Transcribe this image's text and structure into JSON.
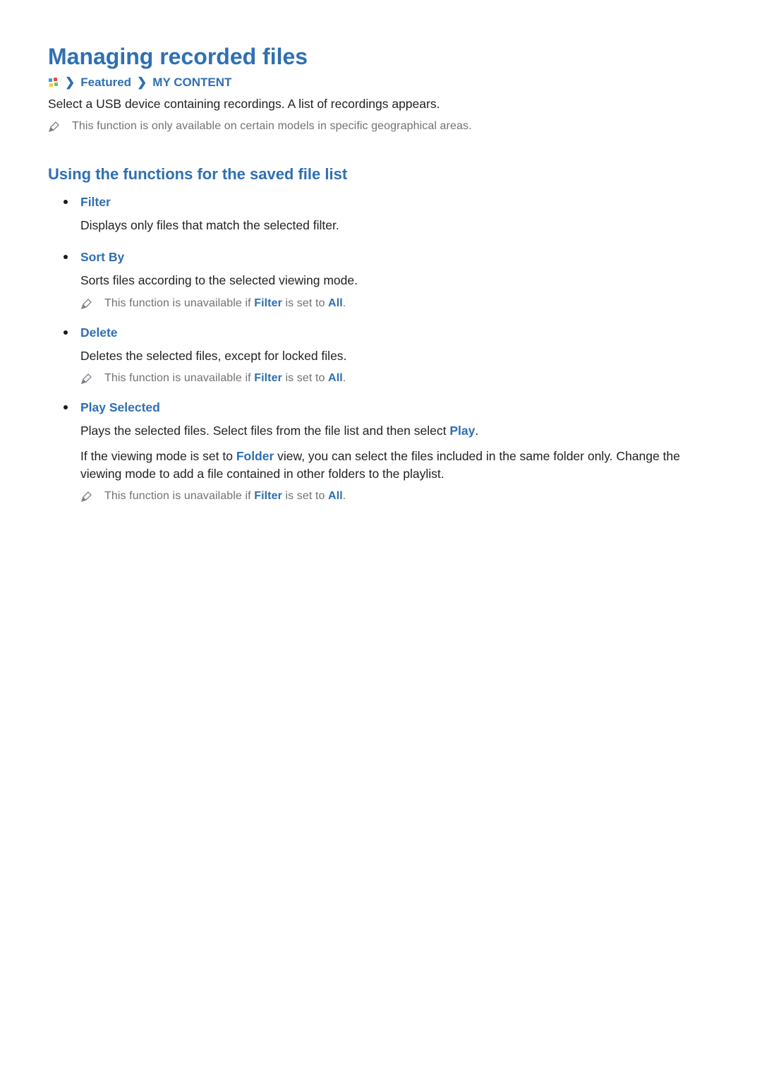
{
  "title": "Managing recorded files",
  "breadcrumb": {
    "item1": "Featured",
    "item2": "MY CONTENT"
  },
  "intro": "Select a USB device containing recordings. A list of recordings appears.",
  "global_note": "This function is only available on certain models in specific geographical areas.",
  "subheading": "Using the functions for the saved file list",
  "items": {
    "filter": {
      "name": "Filter",
      "desc": "Displays only files that match the selected filter."
    },
    "sortby": {
      "name": "Sort By",
      "desc": "Sorts files according to the selected viewing mode.",
      "note_pre": "This function is unavailable if ",
      "note_kw1": "Filter",
      "note_mid": " is set to ",
      "note_kw2": "All",
      "note_post": "."
    },
    "delete": {
      "name": "Delete",
      "desc": "Deletes the selected files, except for locked files.",
      "note_pre": "This function is unavailable if ",
      "note_kw1": "Filter",
      "note_mid": " is set to ",
      "note_kw2": "All",
      "note_post": "."
    },
    "play": {
      "name": "Play Selected",
      "desc1_pre": "Plays the selected files. Select files from the file list and then select ",
      "desc1_kw": "Play",
      "desc1_post": ".",
      "desc2_pre": "If the viewing mode is set to ",
      "desc2_kw": "Folder",
      "desc2_post": " view, you can select the files included in the same folder only. Change the viewing mode to add a file contained in other folders to the playlist.",
      "note_pre": "This function is unavailable if ",
      "note_kw1": "Filter",
      "note_mid": " is set to ",
      "note_kw2": "All",
      "note_post": "."
    }
  }
}
